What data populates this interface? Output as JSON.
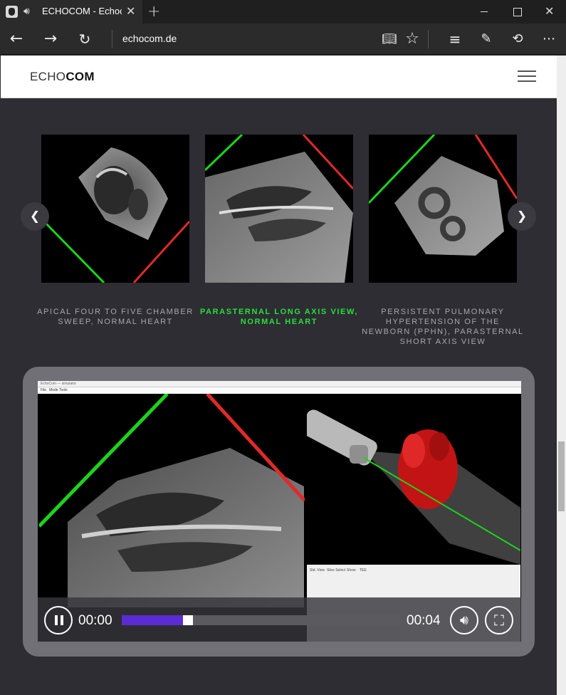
{
  "browser": {
    "tab_title": "ECHOCOM - Echoc",
    "url": "echocom.de"
  },
  "site": {
    "logo_light": "ECHO",
    "logo_bold": "COM"
  },
  "carousel": {
    "items": [
      {
        "caption": "Apical four to five chamber sweep, normal heart",
        "active": false
      },
      {
        "caption": "Parasternal long axis view, normal heart",
        "active": true
      },
      {
        "caption": "Persistent pulmonary hypertension of the newborn (PPHN), parasternal short axis view",
        "active": false
      }
    ]
  },
  "player": {
    "current_time": "00:00",
    "duration": "00:04",
    "progress": 0.22,
    "app_menu": [
      "File",
      "Mode",
      "Tools"
    ],
    "tabs": [
      "Std. View",
      "Slice Select",
      "Show",
      "TEE"
    ]
  },
  "colors": {
    "accent": "#27e03a",
    "progress": "#5b2bd3",
    "background": "#2d2d33"
  }
}
